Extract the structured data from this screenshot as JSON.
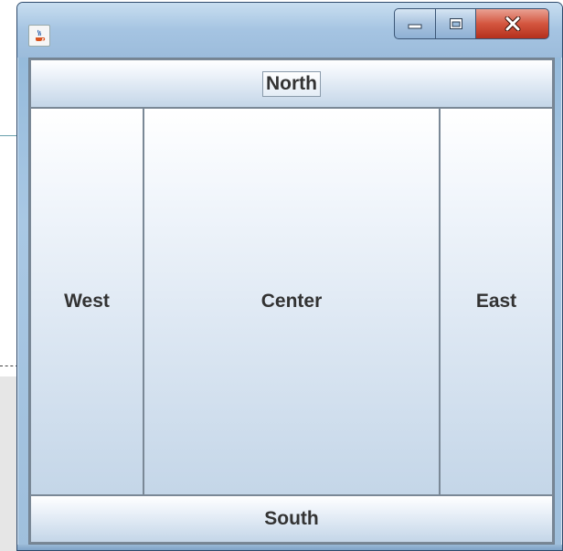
{
  "window": {
    "icon": "java-cup-icon",
    "caption_buttons": [
      "minimize-icon",
      "maximize-icon",
      "close-icon"
    ]
  },
  "layout": {
    "north": "North",
    "west": "West",
    "center": "Center",
    "east": "East",
    "south": "South"
  },
  "colors": {
    "close_button": "#d4563f",
    "title_bar": "#a5c4e2",
    "region_border": "#7a8896"
  }
}
